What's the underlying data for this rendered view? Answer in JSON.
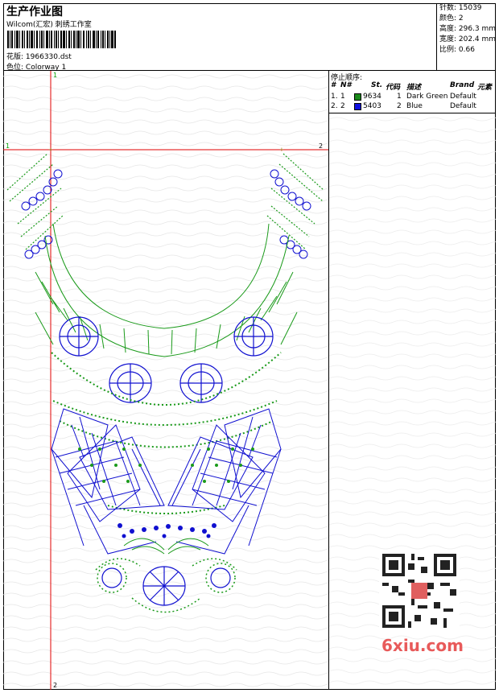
{
  "header": {
    "title": "生产作业图",
    "company": "Wilcom(汇宏) 刺绣工作室",
    "pattern_label": "花版:",
    "pattern_value": "1966330.dst",
    "colorway_label": "色位:",
    "colorway_value": "Colorway 1"
  },
  "stats": {
    "stitches": "针数: 15039",
    "colors": "颜色: 2",
    "height": "高度: 296.3 mm",
    "width": "宽度: 202.4 mm",
    "scale": "比例: 0.66"
  },
  "stop_sequence": {
    "title": "停止顺序:",
    "columns": [
      "#",
      "N#",
      "St.",
      "代码",
      "描述",
      "Brand",
      "元素"
    ],
    "rows": [
      {
        "idx": "1.",
        "n": "1",
        "code": "9634",
        "num": "1",
        "desc": "Dark Green",
        "brand": "Default",
        "color": "#1a8a1a"
      },
      {
        "idx": "2.",
        "n": "2",
        "code": "5403",
        "num": "2",
        "desc": "Blue",
        "brand": "Default",
        "color": "#1010e0"
      }
    ]
  },
  "guides": {
    "v_top": "1",
    "v_bottom": "2",
    "h_left": "1",
    "h_right": "2"
  },
  "watermark": "6xiu.com",
  "colors": {
    "green": "#1a9a1a",
    "blue": "#1010d0",
    "guide": "#e00000"
  }
}
